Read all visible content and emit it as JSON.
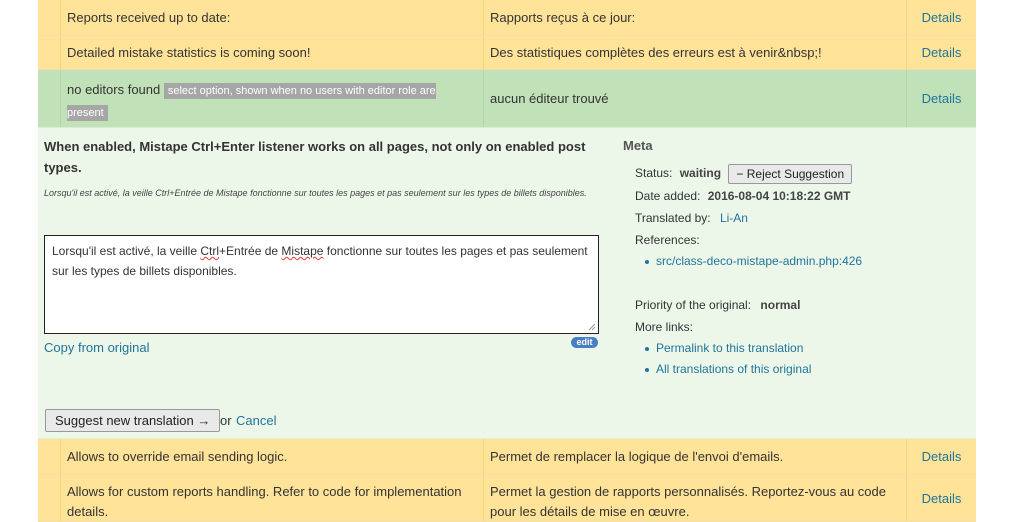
{
  "rows_top": [
    {
      "original": "Reports received up to date:",
      "translation": "Rapports reçus à ce jour:",
      "details": "Details"
    },
    {
      "original": "Detailed mistake statistics is coming soon!",
      "translation": "Des statistiques complètes des erreurs est à venir&nbsp;!",
      "details": "Details"
    }
  ],
  "row_editors": {
    "original": "no editors found",
    "context": "select option, shown when no users with editor role are present",
    "translation": "aucun éditeur trouvé",
    "details": "Details"
  },
  "editor": {
    "original_text": "When enabled, Mistape Ctrl+Enter listener works on all pages, not only on enabled post types.",
    "current_translation": "Lorsqu'il est activé, la veille Ctrl+Entrée de Mistape fonctionne sur toutes les pages et pas seulement sur les types de billets disponibles.",
    "textarea": {
      "part1": "Lorsqu'il est activé, la veille ",
      "word1": "Ctrl",
      "part2": "+Entrée de ",
      "word2": "Mistape",
      "part3": " fonctionne sur toutes les pages et pas seulement sur les types de billets disponibles."
    },
    "copy_link": "Copy from original",
    "edit_badge": "edit",
    "suggest_button": "Suggest new translation →",
    "or_text": "or",
    "cancel_link": "Cancel"
  },
  "meta": {
    "title": "Meta",
    "status_label": "Status:",
    "status_value": "waiting",
    "reject_button": "− Reject Suggestion",
    "date_label": "Date added:",
    "date_value": "2016-08-04 10:18:22 GMT",
    "translated_label": "Translated by:",
    "translated_value": "Li-An",
    "references_label": "References:",
    "references": [
      "src/class-deco-mistape-admin.php:426"
    ],
    "priority_label": "Priority of the original:",
    "priority_value": "normal",
    "more_links_label": "More links:",
    "more_links": [
      "Permalink to this translation",
      "All translations of this original"
    ]
  },
  "rows_bottom": [
    {
      "original": "Allows to override email sending logic.",
      "translation": "Permet de remplacer la logique de l'envoi d'emails.",
      "details": "Details"
    },
    {
      "original": "Allows for custom reports handling. Refer to code for implementation details.",
      "translation": "Permet la gestion de rapports personnalisés. Reportez-vous au code pour les détails de mise en œuvre.",
      "details": "Details"
    }
  ],
  "colors": {
    "row_yellow": "#ffe399",
    "row_green": "#c1e1b9",
    "editor_bg": "#ecf7e9",
    "link": "#21759b"
  }
}
